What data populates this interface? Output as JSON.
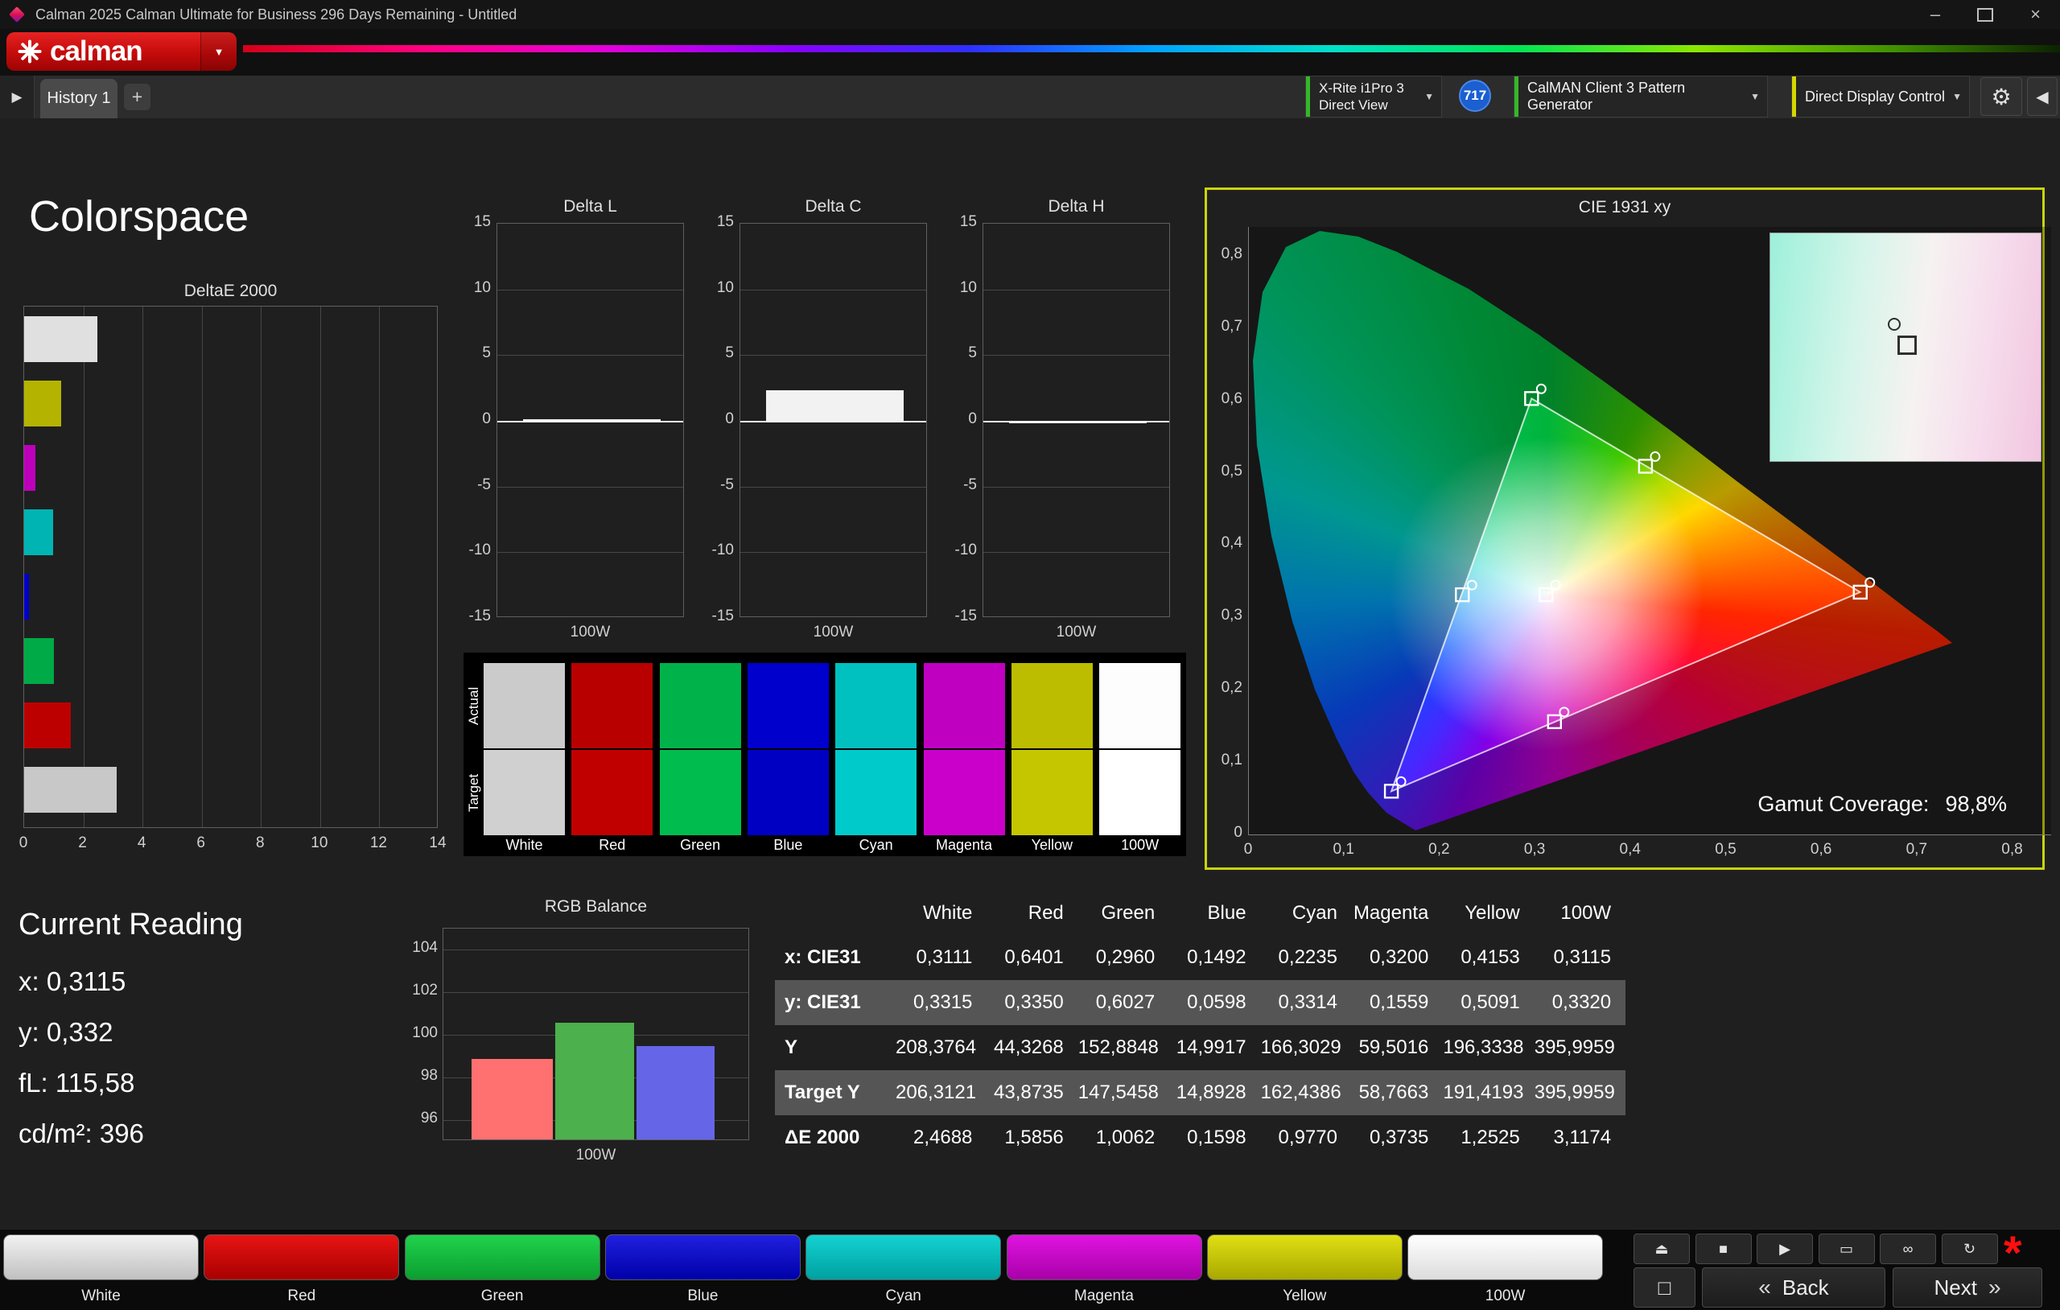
{
  "window": {
    "title": "Calman 2025 Calman Ultimate for Business 296 Days Remaining  - Untitled",
    "controls": {
      "minimize": "–",
      "close": "×"
    }
  },
  "brand": {
    "logo_text": "calman"
  },
  "icons": {
    "caret": "▼",
    "gear": "⚙",
    "collapse": "◀",
    "tab_scroll": "▶"
  },
  "tabs": {
    "history": "History 1",
    "add": "+"
  },
  "toolbar": {
    "meter": {
      "line1": "X-Rite i1Pro 3",
      "line2": "Direct View",
      "status_color": "#35b729"
    },
    "session_badge": "717",
    "pattern_generator": {
      "label": "CalMAN Client 3 Pattern Generator",
      "status_color": "#35b729"
    },
    "display_control": {
      "label": "Direct Display Control",
      "status_color": "#d6d600"
    }
  },
  "page": {
    "title": "Colorspace"
  },
  "current_reading": {
    "title": "Current Reading",
    "lines": [
      {
        "label": "x:",
        "value": "0,3115"
      },
      {
        "label": "y:",
        "value": "0,332"
      },
      {
        "label": "fL:",
        "value": "115,58"
      },
      {
        "label": "cd/m²:",
        "value": "396"
      }
    ]
  },
  "swatches": {
    "row_labels": [
      "Actual",
      "Target"
    ],
    "patches": [
      {
        "label": "White",
        "actual": "#cbcbcb",
        "target": "#d0d0d0"
      },
      {
        "label": "Red",
        "actual": "#b80000",
        "target": "#c00000"
      },
      {
        "label": "Green",
        "actual": "#00b24a",
        "target": "#00bc4e"
      },
      {
        "label": "Blue",
        "actual": "#0000cd",
        "target": "#0000c2"
      },
      {
        "label": "Cyan",
        "actual": "#00c0c0",
        "target": "#00caca"
      },
      {
        "label": "Magenta",
        "actual": "#c000c0",
        "target": "#ca00ca"
      },
      {
        "label": "Yellow",
        "actual": "#bcbc00",
        "target": "#c6c600"
      },
      {
        "label": "100W",
        "actual": "#fdfdfd",
        "target": "#ffffff"
      }
    ]
  },
  "table": {
    "headers": [
      "White",
      "Red",
      "Green",
      "Blue",
      "Cyan",
      "Magenta",
      "Yellow",
      "100W"
    ],
    "rows": [
      {
        "label": "x: CIE31",
        "alt": false,
        "cells": [
          "0,3111",
          "0,6401",
          "0,2960",
          "0,1492",
          "0,2235",
          "0,3200",
          "0,4153",
          "0,3115"
        ]
      },
      {
        "label": "y: CIE31",
        "alt": true,
        "cells": [
          "0,3315",
          "0,3350",
          "0,6027",
          "0,0598",
          "0,3314",
          "0,1559",
          "0,5091",
          "0,3320"
        ]
      },
      {
        "label": "Y",
        "alt": false,
        "cells": [
          "208,3764",
          "44,3268",
          "152,8848",
          "14,9917",
          "166,3029",
          "59,5016",
          "196,3338",
          "395,9959"
        ]
      },
      {
        "label": "Target Y",
        "alt": true,
        "cells": [
          "206,3121",
          "43,8735",
          "147,5458",
          "14,8928",
          "162,4386",
          "58,7663",
          "191,4193",
          "395,9959"
        ]
      },
      {
        "label": "ΔE 2000",
        "alt": false,
        "cells": [
          "2,4688",
          "1,5856",
          "1,0062",
          "0,1598",
          "0,9770",
          "0,3735",
          "1,2525",
          "3,1174"
        ]
      }
    ]
  },
  "pattern_buttons": [
    {
      "label": "White",
      "top": "#f2f2f2",
      "bottom": "#c0c0c0"
    },
    {
      "label": "Red",
      "top": "#e81414",
      "bottom": "#a80000"
    },
    {
      "label": "Green",
      "top": "#20d24c",
      "bottom": "#0b9e30"
    },
    {
      "label": "Blue",
      "top": "#2020e0",
      "bottom": "#0000a8"
    },
    {
      "label": "Cyan",
      "top": "#14d2d2",
      "bottom": "#00a0a0"
    },
    {
      "label": "Magenta",
      "top": "#e014e0",
      "bottom": "#a800a8"
    },
    {
      "label": "Yellow",
      "top": "#e0e014",
      "bottom": "#a8a800"
    },
    {
      "label": "100W",
      "top": "#ffffff",
      "bottom": "#dcdcdc"
    }
  ],
  "transport": [
    {
      "name": "eject",
      "glyph": "⏏"
    },
    {
      "name": "stop",
      "glyph": "■"
    },
    {
      "name": "play",
      "glyph": "▶"
    },
    {
      "name": "pattern-window",
      "glyph": "▭"
    },
    {
      "name": "continuous",
      "glyph": "∞"
    },
    {
      "name": "repeat",
      "glyph": "↻"
    }
  ],
  "nav": {
    "back": "Back",
    "next": "Next",
    "back_arrow": "«",
    "next_arrow": "»",
    "pattern_window_glyph": "□",
    "alert_glyph": "*"
  },
  "chart_data": [
    {
      "id": "deltae2000",
      "type": "bar",
      "orientation": "horizontal",
      "title": "DeltaE 2000",
      "categories": [
        "White",
        "Yellow",
        "Magenta",
        "Cyan",
        "Blue",
        "Green",
        "Red",
        "100W"
      ],
      "values": [
        2.4688,
        1.2525,
        0.3735,
        0.977,
        0.1598,
        1.0062,
        1.5856,
        3.1174
      ],
      "bar_colors": [
        "#e0e0e0",
        "#b4b400",
        "#bc00bc",
        "#00b4b4",
        "#0000c8",
        "#00aa46",
        "#bc0000",
        "#c8c8c8"
      ],
      "xlim": [
        0,
        14
      ],
      "xticks": [
        0,
        2,
        4,
        6,
        8,
        10,
        12,
        14
      ],
      "grid": true
    },
    {
      "id": "delta-l",
      "type": "bar",
      "title": "Delta L",
      "categories": [
        "100W"
      ],
      "values": [
        0.1
      ],
      "ylim": [
        -15,
        15
      ],
      "yticks": [
        15,
        10,
        5,
        0,
        -5,
        -10,
        -15
      ],
      "xlabel": "100W",
      "bar_color": "#f2f2f2"
    },
    {
      "id": "delta-c",
      "type": "bar",
      "title": "Delta C",
      "categories": [
        "100W"
      ],
      "values": [
        2.3
      ],
      "ylim": [
        -15,
        15
      ],
      "yticks": [
        15,
        10,
        5,
        0,
        -5,
        -10,
        -15
      ],
      "xlabel": "100W",
      "bar_color": "#f2f2f2"
    },
    {
      "id": "delta-h",
      "type": "bar",
      "title": "Delta H",
      "categories": [
        "100W"
      ],
      "values": [
        0
      ],
      "ylim": [
        -15,
        15
      ],
      "yticks": [
        15,
        10,
        5,
        0,
        -5,
        -10,
        -15
      ],
      "xlabel": "100W",
      "bar_color": "#f2f2f2"
    },
    {
      "id": "rgb-balance",
      "type": "bar",
      "title": "RGB Balance",
      "categories": [
        "Red",
        "Green",
        "Blue"
      ],
      "values": [
        98.8,
        100.5,
        99.4
      ],
      "ylim": [
        95,
        105
      ],
      "yticks": [
        104,
        102,
        100,
        98,
        96
      ],
      "xlabel": "100W",
      "bar_colors": [
        "#ff7070",
        "#4cb04c",
        "#6565e8"
      ]
    },
    {
      "id": "cie1931",
      "type": "scatter",
      "title": "CIE 1931 xy",
      "xlim": [
        0,
        0.84
      ],
      "ylim": [
        0,
        0.84
      ],
      "xticks": [
        0,
        0.1,
        0.2,
        0.3,
        0.4,
        0.5,
        0.6,
        0.7,
        0.8
      ],
      "yticks": [
        0,
        0.1,
        0.2,
        0.3,
        0.4,
        0.5,
        0.6,
        0.7,
        0.8
      ],
      "points": [
        {
          "name": "White",
          "x": 0.3111,
          "y": 0.3315
        },
        {
          "name": "Red",
          "x": 0.6401,
          "y": 0.335,
          "primary": true
        },
        {
          "name": "Green",
          "x": 0.296,
          "y": 0.6027,
          "primary": true
        },
        {
          "name": "Blue",
          "x": 0.1492,
          "y": 0.0598,
          "primary": true
        },
        {
          "name": "Cyan",
          "x": 0.2235,
          "y": 0.3314
        },
        {
          "name": "Magenta",
          "x": 0.32,
          "y": 0.1559
        },
        {
          "name": "Yellow",
          "x": 0.4153,
          "y": 0.5091
        }
      ],
      "annotation": {
        "label": "Gamut Coverage:",
        "value": "98,8%"
      }
    }
  ]
}
